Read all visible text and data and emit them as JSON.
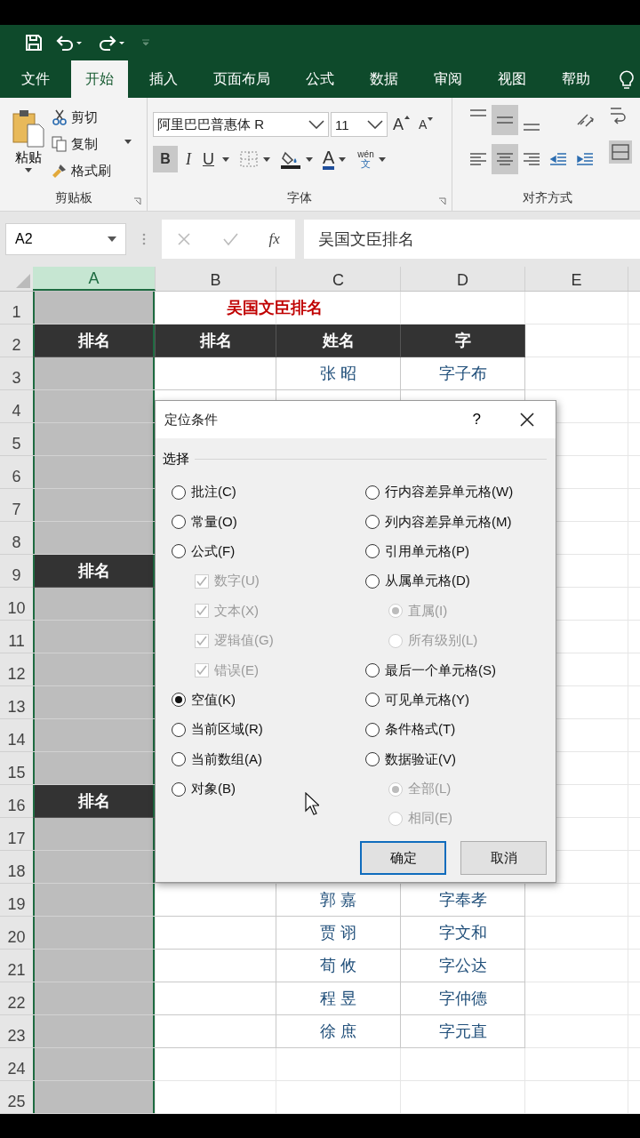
{
  "tabs": [
    {
      "label": "文件",
      "selected": false
    },
    {
      "label": "开始",
      "selected": true
    },
    {
      "label": "插入",
      "selected": false
    },
    {
      "label": "页面布局",
      "selected": false
    },
    {
      "label": "公式",
      "selected": false
    },
    {
      "label": "数据",
      "selected": false
    },
    {
      "label": "审阅",
      "selected": false
    },
    {
      "label": "视图",
      "selected": false
    },
    {
      "label": "帮助",
      "selected": false
    }
  ],
  "ribbon": {
    "clipboard": {
      "paste": "粘贴",
      "cut": "剪切",
      "copy": "复制",
      "format_painter": "格式刷",
      "label": "剪贴板"
    },
    "font": {
      "name": "阿里巴巴普惠体 R",
      "size": "11",
      "grow": "A",
      "shrink": "A",
      "bold": {
        "label": "B",
        "on": true
      },
      "italic": {
        "label": "I",
        "on": false
      },
      "underline": {
        "label": "U",
        "on": false
      },
      "font_color_label": "A",
      "phonetic": "wén",
      "phonetic_char": "文",
      "label": "字体"
    },
    "alignment": {
      "label": "对齐方式",
      "buttons": [
        {
          "kind": "top",
          "on": false
        },
        {
          "kind": "middle",
          "on": true
        },
        {
          "kind": "bottom",
          "on": false
        },
        {
          "kind": "orientation",
          "on": false
        },
        {
          "kind": "left",
          "on": false
        },
        {
          "kind": "center",
          "on": true
        },
        {
          "kind": "right",
          "on": false
        },
        {
          "kind": "outdent",
          "on": false
        },
        {
          "kind": "indent",
          "on": false
        }
      ]
    }
  },
  "formula_bar": {
    "name_box": "A2",
    "function_label": "fx",
    "formula": "吴国文臣排名"
  },
  "columns": [
    {
      "label": "A",
      "selected": true
    },
    {
      "label": "B",
      "selected": false
    },
    {
      "label": "C",
      "selected": false
    },
    {
      "label": "D",
      "selected": false
    },
    {
      "label": "E",
      "selected": false
    }
  ],
  "rows": [
    {
      "number": "1",
      "kind": "title",
      "title": "吴国文臣排名"
    },
    {
      "number": "2",
      "kind": "header",
      "cells": [
        "排名",
        "排名",
        "姓名",
        "字"
      ]
    },
    {
      "number": "3",
      "kind": "data",
      "name": "张 昭",
      "courtesy": "字子布"
    },
    {
      "number": "4",
      "kind": "data"
    },
    {
      "number": "5",
      "kind": "covered"
    },
    {
      "number": "6",
      "kind": "covered"
    },
    {
      "number": "7",
      "kind": "covered"
    },
    {
      "number": "8",
      "kind": "covered"
    },
    {
      "number": "9",
      "kind": "covered",
      "a": "排名"
    },
    {
      "number": "10",
      "kind": "covered"
    },
    {
      "number": "11",
      "kind": "covered"
    },
    {
      "number": "12",
      "kind": "covered"
    },
    {
      "number": "13",
      "kind": "covered"
    },
    {
      "number": "14",
      "kind": "covered"
    },
    {
      "number": "15",
      "kind": "covered"
    },
    {
      "number": "16",
      "kind": "covered",
      "a": "排名"
    },
    {
      "number": "17",
      "kind": "covered"
    },
    {
      "number": "18",
      "kind": "covered"
    },
    {
      "number": "19",
      "kind": "data",
      "name": "郭 嘉",
      "courtesy": "字奉孝"
    },
    {
      "number": "20",
      "kind": "data",
      "name": "贾 诩",
      "courtesy": "字文和"
    },
    {
      "number": "21",
      "kind": "data",
      "name": "荀 攸",
      "courtesy": "字公达"
    },
    {
      "number": "22",
      "kind": "data",
      "name": "程 昱",
      "courtesy": "字仲德"
    },
    {
      "number": "23",
      "kind": "data",
      "name": "徐 庶",
      "courtesy": "字元直"
    },
    {
      "number": "24",
      "kind": "blank"
    },
    {
      "number": "25",
      "kind": "blank"
    }
  ],
  "dialog": {
    "title": "定位条件",
    "help": "?",
    "group_label": "选择",
    "left": [
      {
        "kind": "radio",
        "label": "批注(C)",
        "selected": false,
        "disabled": false
      },
      {
        "kind": "radio",
        "label": "常量(O)",
        "selected": false,
        "disabled": false
      },
      {
        "kind": "radio",
        "label": "公式(F)",
        "selected": false,
        "disabled": false,
        "children": [
          {
            "kind": "checkbox",
            "label": "数字(U)",
            "checked": true,
            "disabled": true
          },
          {
            "kind": "checkbox",
            "label": "文本(X)",
            "checked": true,
            "disabled": true
          },
          {
            "kind": "checkbox",
            "label": "逻辑值(G)",
            "checked": true,
            "disabled": true
          },
          {
            "kind": "checkbox",
            "label": "错误(E)",
            "checked": true,
            "disabled": true
          }
        ]
      },
      {
        "kind": "radio",
        "label": "空值(K)",
        "selected": true,
        "disabled": false
      },
      {
        "kind": "radio",
        "label": "当前区域(R)",
        "selected": false,
        "disabled": false
      },
      {
        "kind": "radio",
        "label": "当前数组(A)",
        "selected": false,
        "disabled": false
      },
      {
        "kind": "radio",
        "label": "对象(B)",
        "selected": false,
        "disabled": false
      }
    ],
    "right": [
      {
        "kind": "radio",
        "label": "行内容差异单元格(W)",
        "selected": false,
        "disabled": false
      },
      {
        "kind": "radio",
        "label": "列内容差异单元格(M)",
        "selected": false,
        "disabled": false
      },
      {
        "kind": "radio",
        "label": "引用单元格(P)",
        "selected": false,
        "disabled": false
      },
      {
        "kind": "radio",
        "label": "从属单元格(D)",
        "selected": false,
        "disabled": false,
        "children": [
          {
            "kind": "radio",
            "label": "直属(I)",
            "selected": true,
            "disabled": true
          },
          {
            "kind": "radio",
            "label": "所有级别(L)",
            "selected": false,
            "disabled": true
          }
        ]
      },
      {
        "kind": "radio",
        "label": "最后一个单元格(S)",
        "selected": false,
        "disabled": false
      },
      {
        "kind": "radio",
        "label": "可见单元格(Y)",
        "selected": false,
        "disabled": false
      },
      {
        "kind": "radio",
        "label": "条件格式(T)",
        "selected": false,
        "disabled": false
      },
      {
        "kind": "radio",
        "label": "数据验证(V)",
        "selected": false,
        "disabled": false,
        "children": [
          {
            "kind": "radio",
            "label": "全部(L)",
            "selected": true,
            "disabled": true
          },
          {
            "kind": "radio",
            "label": "相同(E)",
            "selected": false,
            "disabled": true
          }
        ]
      }
    ],
    "buttons": [
      {
        "label": "确定",
        "default": true
      },
      {
        "label": "取消",
        "default": false
      }
    ]
  }
}
